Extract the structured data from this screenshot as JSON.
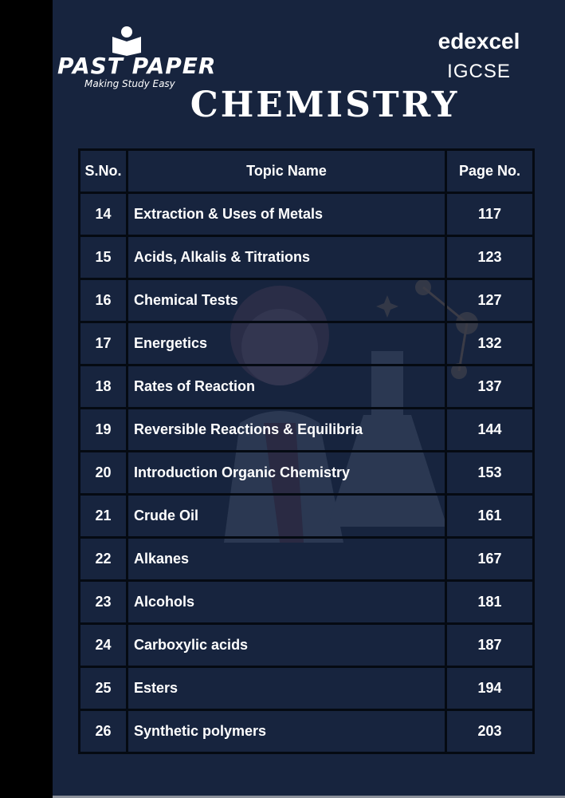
{
  "header": {
    "logo_name": "PAST PAPER",
    "logo_tagline": "Making Study Easy",
    "brand": "edexcel",
    "level": "IGCSE",
    "title": "CHEMISTRY"
  },
  "table": {
    "headers": {
      "sno": "S.No.",
      "topic": "Topic Name",
      "page": "Page No."
    },
    "rows": [
      {
        "sno": "14",
        "topic": "Extraction & Uses of Metals",
        "page": "117"
      },
      {
        "sno": "15",
        "topic": "Acids, Alkalis & Titrations",
        "page": "123"
      },
      {
        "sno": "16",
        "topic": "Chemical Tests",
        "page": "127"
      },
      {
        "sno": "17",
        "topic": "Energetics",
        "page": "132"
      },
      {
        "sno": "18",
        "topic": "Rates of Reaction",
        "page": "137"
      },
      {
        "sno": "19",
        "topic": "Reversible Reactions & Equilibria",
        "page": "144"
      },
      {
        "sno": "20",
        "topic": "Introduction Organic Chemistry",
        "page": "153"
      },
      {
        "sno": "21",
        "topic": "Crude Oil",
        "page": "161"
      },
      {
        "sno": "22",
        "topic": "Alkanes",
        "page": "167"
      },
      {
        "sno": "23",
        "topic": "Alcohols",
        "page": "181"
      },
      {
        "sno": "24",
        "topic": "Carboxylic acids",
        "page": "187"
      },
      {
        "sno": "25",
        "topic": "Esters",
        "page": "194"
      },
      {
        "sno": "26",
        "topic": "Synthetic polymers",
        "page": "203"
      }
    ]
  },
  "colors": {
    "background": "#17243e",
    "text": "#ffffff",
    "border": "#050a12"
  }
}
